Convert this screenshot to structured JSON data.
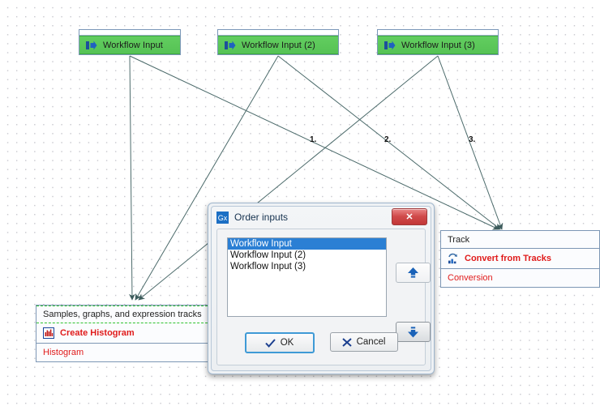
{
  "app": {
    "canvas_name": "workflow-canvas",
    "accent_green": "#56c355",
    "accent_red": "#e01b1b",
    "accent_blue": "#2b7fd4"
  },
  "workflow_inputs": [
    {
      "label": "Workflow Input",
      "icon": "workflow-input-icon"
    },
    {
      "label": "Workflow Input (2)",
      "icon": "workflow-input-icon"
    },
    {
      "label": "Workflow Input (3)",
      "icon": "workflow-input-icon"
    }
  ],
  "edge_labels": [
    "1.",
    "2.",
    "3."
  ],
  "nodes": {
    "histogram": {
      "input_label": "Samples, graphs, and expression tracks",
      "title": "Create Histogram",
      "output_label": "Histogram",
      "icon": "histogram-icon"
    },
    "convert": {
      "input_label": "Track",
      "title": "Convert from Tracks",
      "output_label": "Conversion",
      "icon": "convert-from-tracks-icon"
    }
  },
  "dialog": {
    "title": "Order inputs",
    "icon": "gx-icon",
    "close_label": "✕",
    "list": [
      {
        "label": "Workflow Input",
        "selected": true
      },
      {
        "label": "Workflow Input (2)",
        "selected": false
      },
      {
        "label": "Workflow Input (3)",
        "selected": false
      }
    ],
    "move_up_label": "",
    "move_down_label": "",
    "ok_label": "OK",
    "cancel_label": "Cancel"
  }
}
